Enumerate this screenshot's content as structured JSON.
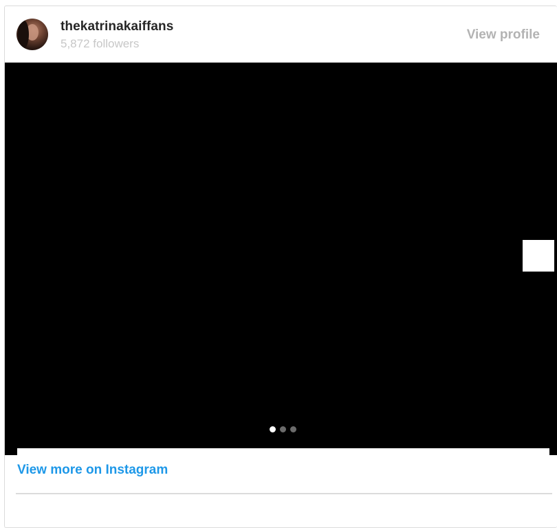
{
  "header": {
    "username": "thekatrinakaiffans",
    "followers": "5,872 followers",
    "view_profile_label": "View profile"
  },
  "media": {
    "carousel_total": 3,
    "carousel_active_index": 0
  },
  "footer": {
    "view_more_label": "View more on Instagram"
  },
  "colors": {
    "link_blue": "#1e98e8",
    "muted_gray": "#b3b3b3",
    "media_background": "#000000"
  }
}
